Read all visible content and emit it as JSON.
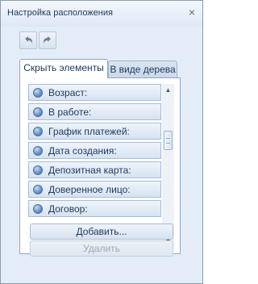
{
  "window": {
    "title": "Настройка расположения",
    "close_glyph": "×"
  },
  "toolbar": {
    "undo_icon": "undo-arrow-icon",
    "redo_icon": "redo-arrow-icon"
  },
  "tabs": [
    {
      "label": "Скрыть элементы",
      "active": true
    },
    {
      "label": "В виде дерева",
      "active": false
    }
  ],
  "hidden_items": [
    {
      "label": "Возраст:"
    },
    {
      "label": "В работе:"
    },
    {
      "label": "График платежей:"
    },
    {
      "label": "Дата создания:"
    },
    {
      "label": "Депозитная карта:"
    },
    {
      "label": "Доверенное лицо:"
    },
    {
      "label": "Договор:"
    }
  ],
  "scrollbar": {
    "up_glyph": "▲",
    "down_glyph": "▼"
  },
  "buttons": {
    "add_label": "Добавить...",
    "delete_label": "Удалить"
  },
  "colors": {
    "accent": "#1e395b",
    "window_bg": "#e4ecf7",
    "disabled_text": "#9aa7b8"
  }
}
